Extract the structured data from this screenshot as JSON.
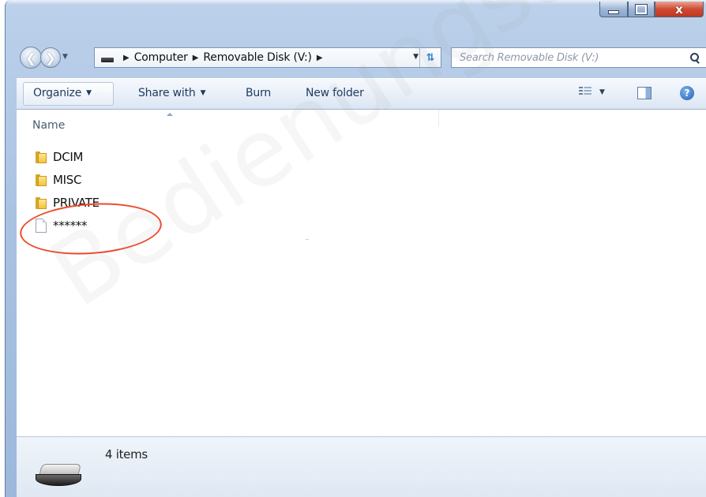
{
  "window": {
    "caption_buttons": {
      "minimize": "minimize-icon",
      "maximize": "maximize-icon",
      "close_label": "x"
    }
  },
  "navigation": {
    "back_icon": "back-arrow-icon",
    "forward_icon": "forward-arrow-icon"
  },
  "address_bar": {
    "icon": "drive-icon",
    "breadcrumbs": [
      "Computer",
      "Removable Disk (V:)"
    ],
    "refresh_icon": "refresh-icon"
  },
  "search": {
    "placeholder": "Search Removable Disk (V:)",
    "icon": "search-icon"
  },
  "toolbar": {
    "organize": "Organize",
    "share_with": "Share with",
    "burn": "Burn",
    "new_folder": "New folder",
    "view_icon": "view-options-icon",
    "preview_pane_icon": "preview-pane-icon",
    "help_label": "?"
  },
  "file_list": {
    "column_name": "Name",
    "items": [
      {
        "name": "DCIM",
        "type": "folder",
        "icon": "folder-icon"
      },
      {
        "name": "MISC",
        "type": "folder",
        "icon": "folder-icon"
      },
      {
        "name": "PRIVATE",
        "type": "folder",
        "icon": "folder-icon"
      },
      {
        "name": "******",
        "type": "file",
        "icon": "file-icon"
      }
    ]
  },
  "details_pane": {
    "item_count": "4 items",
    "icon": "removable-drive-icon"
  },
  "watermark": "Bedienungsanleitu",
  "colors": {
    "annotation_circle": "#ee4a2b",
    "titlebar": "#a9c2e2",
    "close_button": "#cf4b34"
  }
}
